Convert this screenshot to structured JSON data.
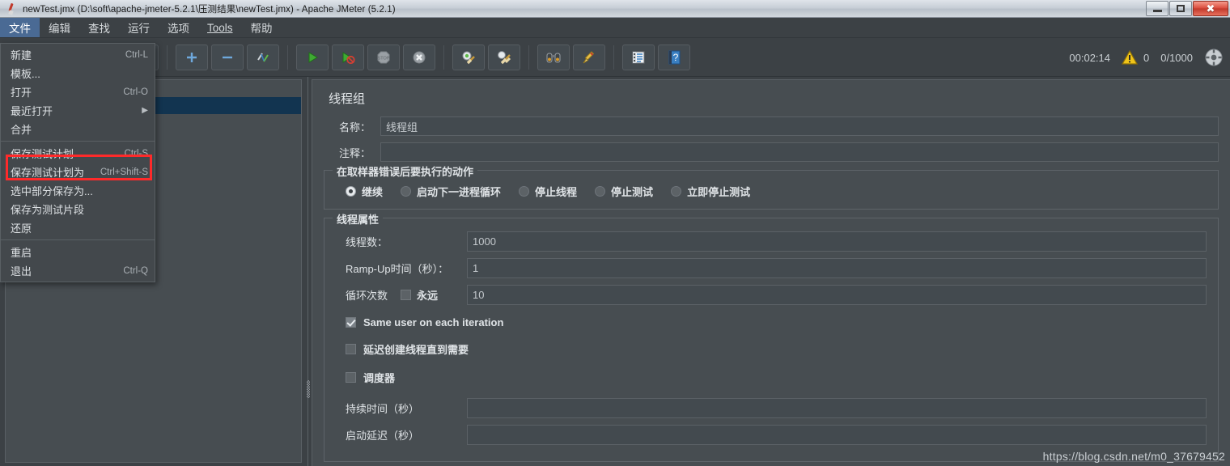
{
  "window": {
    "title": "newTest.jmx (D:\\soft\\apache-jmeter-5.2.1\\压测结果\\newTest.jmx) - Apache JMeter (5.2.1)",
    "app_icon": "jmeter-feather-icon",
    "minimize_label": "–",
    "maximize_label": "□",
    "close_label": "✕"
  },
  "menubar": {
    "items": [
      {
        "label": "文件",
        "active": true
      },
      {
        "label": "编辑",
        "active": false
      },
      {
        "label": "查找",
        "active": false
      },
      {
        "label": "运行",
        "active": false
      },
      {
        "label": "选项",
        "active": false
      },
      {
        "label": "Tools",
        "active": false,
        "underline_first": true
      },
      {
        "label": "帮助",
        "active": false
      }
    ]
  },
  "file_menu": {
    "items": [
      {
        "label": "新建",
        "accel": "Ctrl-L",
        "type": "item"
      },
      {
        "label": "模板...",
        "accel": "",
        "type": "item"
      },
      {
        "label": "打开",
        "accel": "Ctrl-O",
        "type": "item"
      },
      {
        "label": "最近打开",
        "accel": "",
        "type": "submenu"
      },
      {
        "label": "合并",
        "accel": "",
        "type": "item"
      },
      {
        "type": "separator"
      },
      {
        "label": "保存测试计划",
        "accel": "Ctrl-S",
        "type": "item"
      },
      {
        "label": "保存测试计划为",
        "accel": "Ctrl+Shift-S",
        "type": "item",
        "highlighted": true
      },
      {
        "label": "选中部分保存为...",
        "accel": "",
        "type": "item"
      },
      {
        "label": "保存为测试片段",
        "accel": "",
        "type": "item"
      },
      {
        "label": "还原",
        "accel": "",
        "type": "item"
      },
      {
        "type": "separator"
      },
      {
        "label": "重启",
        "accel": "",
        "type": "item"
      },
      {
        "label": "退出",
        "accel": "Ctrl-Q",
        "type": "item"
      }
    ]
  },
  "toolbar": {
    "buttons": [
      {
        "icon": "save-icon",
        "name": "save-button"
      },
      {
        "icon": "cut-scissors-icon",
        "name": "cut-button"
      },
      {
        "icon": "copy-icon",
        "name": "copy-button"
      },
      {
        "icon": "paste-clipboard-icon",
        "name": "paste-button"
      },
      {
        "icon": "plus-icon",
        "name": "expand-button"
      },
      {
        "icon": "minus-icon",
        "name": "collapse-button"
      },
      {
        "icon": "toggle-icon",
        "name": "toggle-button"
      },
      {
        "icon": "play-icon",
        "name": "start-button"
      },
      {
        "icon": "play-no-timers-icon",
        "name": "start-no-pauses-button"
      },
      {
        "icon": "stop-icon",
        "name": "stop-button"
      },
      {
        "icon": "shutdown-icon",
        "name": "shutdown-button"
      },
      {
        "icon": "clear-gear-broom-icon",
        "name": "clear-button"
      },
      {
        "icon": "clear-all-broom-icon",
        "name": "clear-all-button"
      },
      {
        "icon": "binoculars-search-icon",
        "name": "search-button"
      },
      {
        "icon": "broom-reset-icon",
        "name": "reset-search-button"
      },
      {
        "icon": "function-helper-icon",
        "name": "function-helper-button"
      },
      {
        "icon": "help-book-icon",
        "name": "help-button"
      }
    ]
  },
  "status": {
    "elapsed_time": "00:02:14",
    "warning_icon": "warning-triangle-icon",
    "warning_count": "0",
    "threads": "0/1000",
    "connection_icon": "remote-connection-icon"
  },
  "panel": {
    "title": "线程组",
    "name_label": "名称：",
    "name_value": "线程组",
    "comment_label": "注释：",
    "comment_value": "",
    "on_error": {
      "group_title": "在取样器错误后要执行的动作",
      "options": [
        {
          "label": "继续",
          "checked": true
        },
        {
          "label": "启动下一进程循环",
          "checked": false
        },
        {
          "label": "停止线程",
          "checked": false
        },
        {
          "label": "停止测试",
          "checked": false
        },
        {
          "label": "立即停止测试",
          "checked": false
        }
      ]
    },
    "thread_props": {
      "group_title": "线程属性",
      "threads_label": "线程数：",
      "threads_value": "1000",
      "rampup_label": "Ramp-Up时间（秒）：",
      "rampup_value": "1",
      "loop_label": "循环次数",
      "forever_label": "永远",
      "forever_checked": false,
      "loop_value": "10",
      "same_user_label": "Same user on each iteration",
      "same_user_checked": true,
      "delay_create_label": "延迟创建线程直到需要",
      "delay_create_checked": false,
      "scheduler_label": "调度器",
      "scheduler_checked": false,
      "duration_label": "持续时间（秒）",
      "duration_value": "",
      "startup_delay_label": "启动延迟（秒）",
      "startup_delay_value": ""
    }
  },
  "watermark": "https://blog.csdn.net/m0_37679452",
  "colors": {
    "accent_blue": "#4a6a94",
    "panel_bg": "#474d51",
    "window_bg": "#3c4145",
    "input_bg": "#434a4f",
    "highlight_red": "#ff2a2a",
    "tree_selected": "#123450"
  }
}
